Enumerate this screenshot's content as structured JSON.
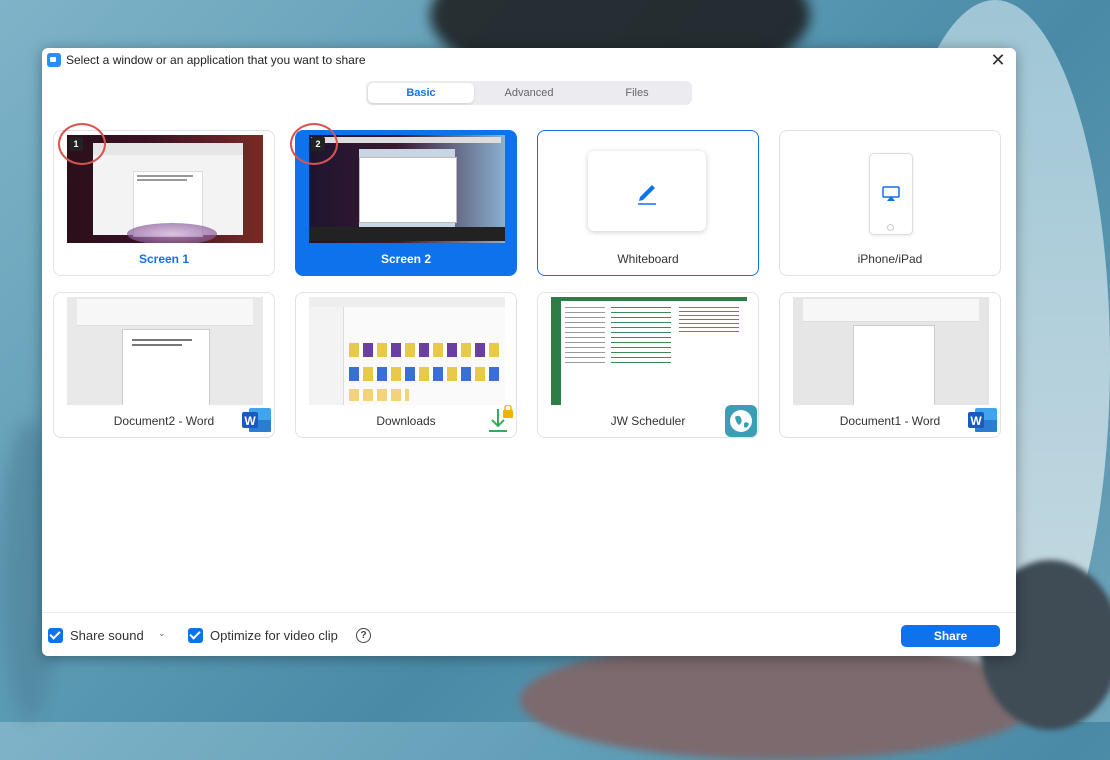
{
  "dialog": {
    "title": "Select a window or an application that you want to share",
    "close_glyph": "✕"
  },
  "tabs": [
    {
      "label": "Basic",
      "active": true
    },
    {
      "label": "Advanced",
      "active": false
    },
    {
      "label": "Files",
      "active": false
    }
  ],
  "tiles": [
    {
      "label": "Screen 1",
      "badge": "1",
      "kind": "screen"
    },
    {
      "label": "Screen 2",
      "badge": "2",
      "kind": "screen",
      "selected": true
    },
    {
      "label": "Whiteboard",
      "kind": "whiteboard",
      "icon": "pencil-icon"
    },
    {
      "label": "iPhone/iPad",
      "kind": "device",
      "icon": "airplay-icon"
    },
    {
      "label": "Document2 - Word",
      "kind": "window",
      "app_icon": "word-icon"
    },
    {
      "label": "Downloads",
      "kind": "window",
      "app_icon": "download-icon"
    },
    {
      "label": "JW Scheduler",
      "kind": "window",
      "app_icon": "globe-icon"
    },
    {
      "label": "Document1 - Word",
      "kind": "window",
      "app_icon": "word-icon"
    }
  ],
  "footer": {
    "share_sound": "Share sound",
    "optimize": "Optimize for video clip",
    "help_glyph": "?",
    "chevron": "⌄",
    "share_button": "Share"
  },
  "colors": {
    "accent": "#0e72ed",
    "badge_ring": "#d9534f",
    "word_blue": "#185abd",
    "jw_green": "#2f7d46"
  }
}
